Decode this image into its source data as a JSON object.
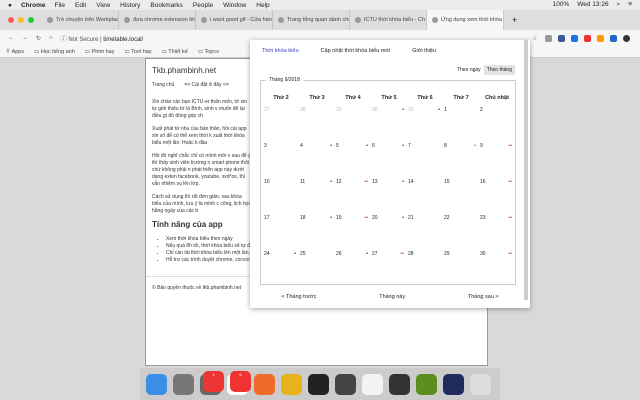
{
  "menubar": {
    "app": "Chrome",
    "items": [
      "File",
      "Edit",
      "View",
      "History",
      "Bookmarks",
      "People",
      "Window",
      "Help"
    ],
    "battery": "100%",
    "clock": "Wed 13:26"
  },
  "tabs": [
    "Trò chuyện trên Workplace",
    "đưa chrome extension lên",
    "i want good gif - Cửa hàng",
    "Trang tổng quan dành cho",
    "ICTU thời khóa biểu - Ch",
    "Ứng dụng xem thời khóa"
  ],
  "address": {
    "security": "Not Secure",
    "url": "timetable.local/"
  },
  "bookmarks": [
    "Apps",
    "Học tiếng anh",
    "Phim hay",
    "Tool hay",
    "Thiết kế",
    "Topcv"
  ],
  "page": {
    "title": "Tkb.phambinh.net",
    "nav": [
      "Trang chủ",
      "=> Cài đặt ở đây <="
    ],
    "paragraphs": [
      "Xin chào các bạn ICTU-er thân mến, tớ xin tự giới thiệu tớ là Bình, sinh v muốn để lại điều gì đó đóng góp ch",
      "Xuất phát từ nhu cầu bản thân, hồi cái app xin số để có thể xem thời k xuất thời khóa biểu một lần. Hoặc k đầu",
      "Hồi đó nghĩ chắc chỉ có mình mới v sau để ý thì thấy sinh viên trường n smart phone thôi chứ không phải n phát triển app này dưới dạng exten facebook, youtube, xxd*os, thì vẫn nhiệm vụ lên lớp.",
      "Cách sử dụng thì rất đơn giản, sau khóa biểu của mình, lưu ý là mình c công, lịch học hằng ngày của các b"
    ],
    "features_title": "Tính năng của app",
    "features": [
      "Xem thời khóa biểu theo ngày",
      "Nếu quá 8h tối, thời khóa biểu sẽ tự động chuyển sang ngày mai",
      "Chỉ cần tải thời khóa biểu lên một lần, lần sau ngay cả khi offline bạn vẫn có thể xem thời khóa biểu",
      "Hỗ trợ các trình duyệt chrome, coccoc, opera"
    ],
    "footer": "© Bản quyền thuộc về tkb.phambinh.net"
  },
  "popup": {
    "tabs": [
      "Thời khóa biểu",
      "Cập nhật thời khóa biểu mới",
      "Giới thiệu"
    ],
    "view": [
      "Theo ngày",
      "Theo tháng"
    ],
    "month": "Tháng 9/2018",
    "weekdays": [
      "Thứ 2",
      "Thứ 3",
      "Thứ 4",
      "Thứ 5",
      "Thứ 6",
      "Thứ 7",
      "Chủ nhật"
    ],
    "weeks": [
      [
        {
          "d": "27",
          "m": 1,
          "k": ""
        },
        {
          "d": "28",
          "m": 1,
          "k": ""
        },
        {
          "d": "29",
          "m": 1,
          "k": ""
        },
        {
          "d": "30",
          "m": 1,
          "k": "•"
        },
        {
          "d": "31",
          "m": 1,
          "k": "•"
        },
        {
          "d": "1",
          "k": ""
        },
        {
          "d": "2",
          "k": ""
        }
      ],
      [
        {
          "d": "3",
          "k": ""
        },
        {
          "d": "4",
          "k": "•"
        },
        {
          "d": "5",
          "k": "•"
        },
        {
          "d": "6",
          "k": "•"
        },
        {
          "d": "7",
          "k": ""
        },
        {
          "d": "8",
          "k": "•",
          "r": 1
        },
        {
          "d": "9",
          "k": "••",
          "r": 1
        }
      ],
      [
        {
          "d": "10",
          "k": ""
        },
        {
          "d": "11",
          "k": "•"
        },
        {
          "d": "12",
          "k": "••",
          "r": 1
        },
        {
          "d": "13",
          "k": "•"
        },
        {
          "d": "14",
          "k": ""
        },
        {
          "d": "15",
          "k": ""
        },
        {
          "d": "16",
          "k": "••",
          "r": 1
        }
      ],
      [
        {
          "d": "17",
          "k": ""
        },
        {
          "d": "18",
          "k": "•"
        },
        {
          "d": "19",
          "k": "••",
          "r": 1
        },
        {
          "d": "20",
          "k": "•"
        },
        {
          "d": "21",
          "k": ""
        },
        {
          "d": "22",
          "k": ""
        },
        {
          "d": "23",
          "k": "••",
          "r": 1
        }
      ],
      [
        {
          "d": "24",
          "k": "•"
        },
        {
          "d": "25",
          "k": ""
        },
        {
          "d": "26",
          "k": "•"
        },
        {
          "d": "27",
          "k": "••",
          "r": 1
        },
        {
          "d": "28",
          "k": ""
        },
        {
          "d": "29",
          "k": ""
        },
        {
          "d": "30",
          "k": "••",
          "r": 1
        }
      ]
    ],
    "prev": "< Tháng trước",
    "current": "Tháng này",
    "next": "Tháng sau >"
  },
  "dock": [
    {
      "name": "finder",
      "color": "#3a8ee6"
    },
    {
      "name": "launchpad",
      "color": "#777"
    },
    {
      "name": "system-preferences",
      "color": "#666",
      "badge": "1"
    },
    {
      "name": "slack",
      "color": "#fff",
      "badge": "6"
    },
    {
      "name": "safari",
      "color": "#f06a2a"
    },
    {
      "name": "chrome",
      "color": "#e8b21c"
    },
    {
      "name": "terminal",
      "color": "#222"
    },
    {
      "name": "sublime",
      "color": "#444"
    },
    {
      "name": "coccoc",
      "color": "#f4f4f4"
    },
    {
      "name": "workplace",
      "color": "#333"
    },
    {
      "name": "vim",
      "color": "#5a8f1f"
    },
    {
      "name": "photoshop",
      "color": "#1e2b5c"
    },
    {
      "name": "trash",
      "color": "#ddd"
    }
  ],
  "colors": {
    "accent": "#3b3bc9",
    "mark_red": "#e0245e"
  }
}
